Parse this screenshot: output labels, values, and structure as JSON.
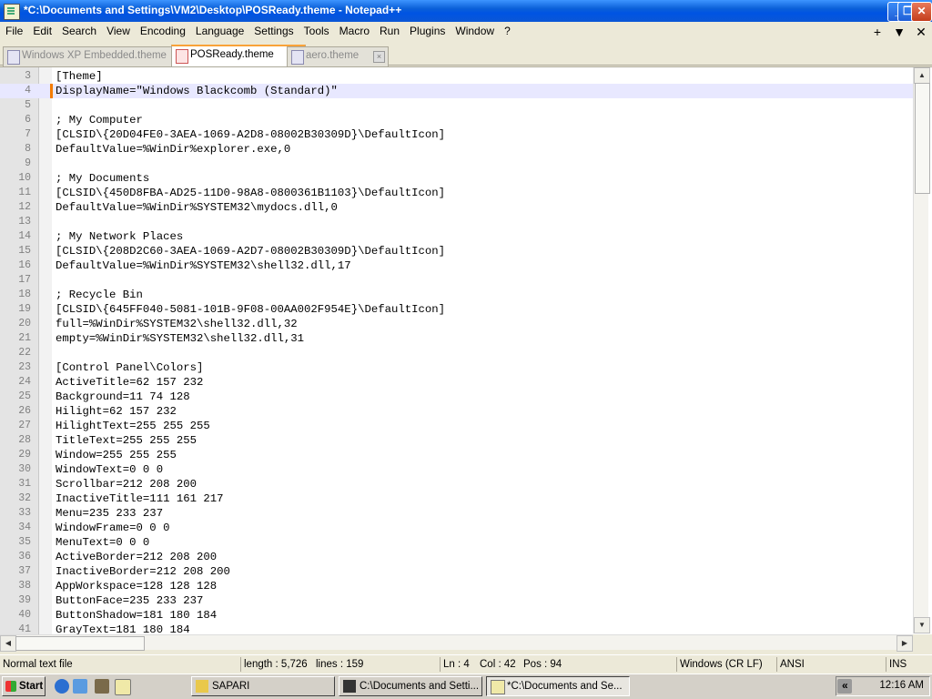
{
  "window": {
    "title": "*C:\\Documents and Settings\\VM2\\Desktop\\POSReady.theme - Notepad++",
    "minimize": "_",
    "maximize": "❐",
    "close": "✕"
  },
  "menu": {
    "items": [
      "File",
      "Edit",
      "Search",
      "View",
      "Encoding",
      "Language",
      "Settings",
      "Tools",
      "Macro",
      "Run",
      "Plugins",
      "Window",
      "?"
    ],
    "right": [
      "+",
      "▼",
      "✕"
    ]
  },
  "tabs": [
    {
      "label": "Windows XP Embedded.theme",
      "close": "×"
    },
    {
      "label": "POSReady.theme",
      "close": "×"
    },
    {
      "label": "aero.theme",
      "close": "×"
    }
  ],
  "editor": {
    "lines": [
      {
        "n": "3",
        "text": "[Theme]"
      },
      {
        "n": "4",
        "text": "DisplayName=\"Windows Blackcomb (Standard)\""
      },
      {
        "n": "5",
        "text": ""
      },
      {
        "n": "6",
        "text": "; My Computer"
      },
      {
        "n": "7",
        "text": "[CLSID\\{20D04FE0-3AEA-1069-A2D8-08002B30309D}\\DefaultIcon]"
      },
      {
        "n": "8",
        "text": "DefaultValue=%WinDir%explorer.exe,0"
      },
      {
        "n": "9",
        "text": ""
      },
      {
        "n": "10",
        "text": "; My Documents"
      },
      {
        "n": "11",
        "text": "[CLSID\\{450D8FBA-AD25-11D0-98A8-0800361B1103}\\DefaultIcon]"
      },
      {
        "n": "12",
        "text": "DefaultValue=%WinDir%SYSTEM32\\mydocs.dll,0"
      },
      {
        "n": "13",
        "text": ""
      },
      {
        "n": "14",
        "text": "; My Network Places"
      },
      {
        "n": "15",
        "text": "[CLSID\\{208D2C60-3AEA-1069-A2D7-08002B30309D}\\DefaultIcon]"
      },
      {
        "n": "16",
        "text": "DefaultValue=%WinDir%SYSTEM32\\shell32.dll,17"
      },
      {
        "n": "17",
        "text": ""
      },
      {
        "n": "18",
        "text": "; Recycle Bin"
      },
      {
        "n": "19",
        "text": "[CLSID\\{645FF040-5081-101B-9F08-00AA002F954E}\\DefaultIcon]"
      },
      {
        "n": "20",
        "text": "full=%WinDir%SYSTEM32\\shell32.dll,32"
      },
      {
        "n": "21",
        "text": "empty=%WinDir%SYSTEM32\\shell32.dll,31"
      },
      {
        "n": "22",
        "text": ""
      },
      {
        "n": "23",
        "text": "[Control Panel\\Colors]"
      },
      {
        "n": "24",
        "text": "ActiveTitle=62 157 232"
      },
      {
        "n": "25",
        "text": "Background=11 74 128"
      },
      {
        "n": "26",
        "text": "Hilight=62 157 232"
      },
      {
        "n": "27",
        "text": "HilightText=255 255 255"
      },
      {
        "n": "28",
        "text": "TitleText=255 255 255"
      },
      {
        "n": "29",
        "text": "Window=255 255 255"
      },
      {
        "n": "30",
        "text": "WindowText=0 0 0"
      },
      {
        "n": "31",
        "text": "Scrollbar=212 208 200"
      },
      {
        "n": "32",
        "text": "InactiveTitle=111 161 217"
      },
      {
        "n": "33",
        "text": "Menu=235 233 237"
      },
      {
        "n": "34",
        "text": "WindowFrame=0 0 0"
      },
      {
        "n": "35",
        "text": "MenuText=0 0 0"
      },
      {
        "n": "36",
        "text": "ActiveBorder=212 208 200"
      },
      {
        "n": "37",
        "text": "InactiveBorder=212 208 200"
      },
      {
        "n": "38",
        "text": "AppWorkspace=128 128 128"
      },
      {
        "n": "39",
        "text": "ButtonFace=235 233 237"
      },
      {
        "n": "40",
        "text": "ButtonShadow=181 180 184"
      },
      {
        "n": "41",
        "text": "GrayText=181 180 184"
      }
    ]
  },
  "status": {
    "type": "Normal text file",
    "length": "length : 5,726",
    "lines": "lines : 159",
    "ln": "Ln : 4",
    "col": "Col : 42",
    "pos": "Pos : 94",
    "eol": "Windows (CR LF)",
    "encoding": "ANSI",
    "mode": "INS"
  },
  "taskbar": {
    "start": "Start",
    "tasks": [
      "SAPARI",
      "C:\\Documents and Setti...",
      "*C:\\Documents and Se..."
    ],
    "tray_arrow": "«",
    "clock": "12:16 AM"
  },
  "colors": {
    "titlebar": "#0054e3",
    "active_tab_accent": "#f9a238",
    "current_line": "#e8e8ff"
  }
}
